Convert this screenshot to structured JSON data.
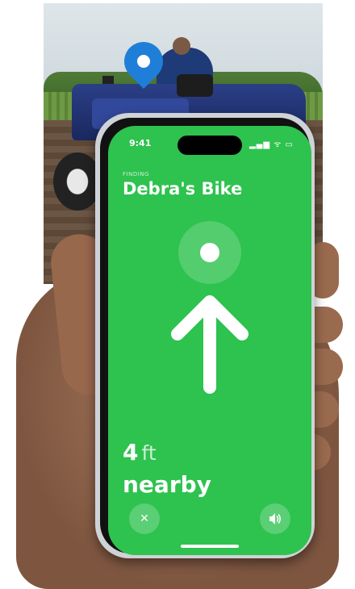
{
  "status_bar": {
    "time": "9:41",
    "indicators": "▂▄▆ ᯤ ▭"
  },
  "finding": {
    "label": "FINDING",
    "device_name": "Debra's Bike"
  },
  "direction": {
    "icon": "arrow-up-icon"
  },
  "distance": {
    "value": "4",
    "unit": "ft",
    "proximity": "nearby"
  },
  "controls": {
    "close_icon": "close-icon",
    "close_glyph": "✕",
    "sound_icon": "speaker-icon"
  },
  "colors": {
    "screen_green": "#2ec24f",
    "map_pin": "#1f7fd8"
  }
}
